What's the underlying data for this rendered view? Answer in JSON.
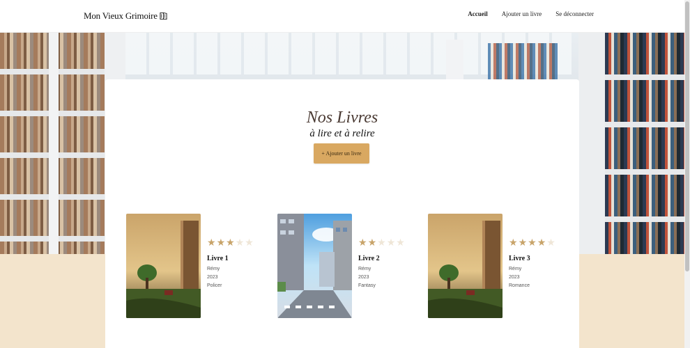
{
  "header": {
    "logo": "Mon Vieux Grimoire",
    "nav": {
      "home": "Accueil",
      "add_book": "Ajouter un livre",
      "logout": "Se déconnecter"
    }
  },
  "main": {
    "title": "Nos Livres",
    "subtitle": "à lire et à relire",
    "add_button": "+ Ajouter un livre"
  },
  "books": [
    {
      "title": "Livre 1",
      "author": "Rémy",
      "year": "2023",
      "genre": "Policer",
      "rating": 3,
      "cover": "book-in-nature"
    },
    {
      "title": "Livre 2",
      "author": "Rémy",
      "year": "2023",
      "genre": "Fantasy",
      "rating": 2,
      "cover": "anime-street"
    },
    {
      "title": "Livre 3",
      "author": "Rémy",
      "year": "2023",
      "genre": "Romance",
      "rating": 4,
      "cover": "book-in-nature"
    }
  ],
  "colors": {
    "accent": "#d9a861",
    "star_on": "#c8a46a",
    "star_off": "#efe6d7",
    "page_bg": "#f3e4cc"
  }
}
